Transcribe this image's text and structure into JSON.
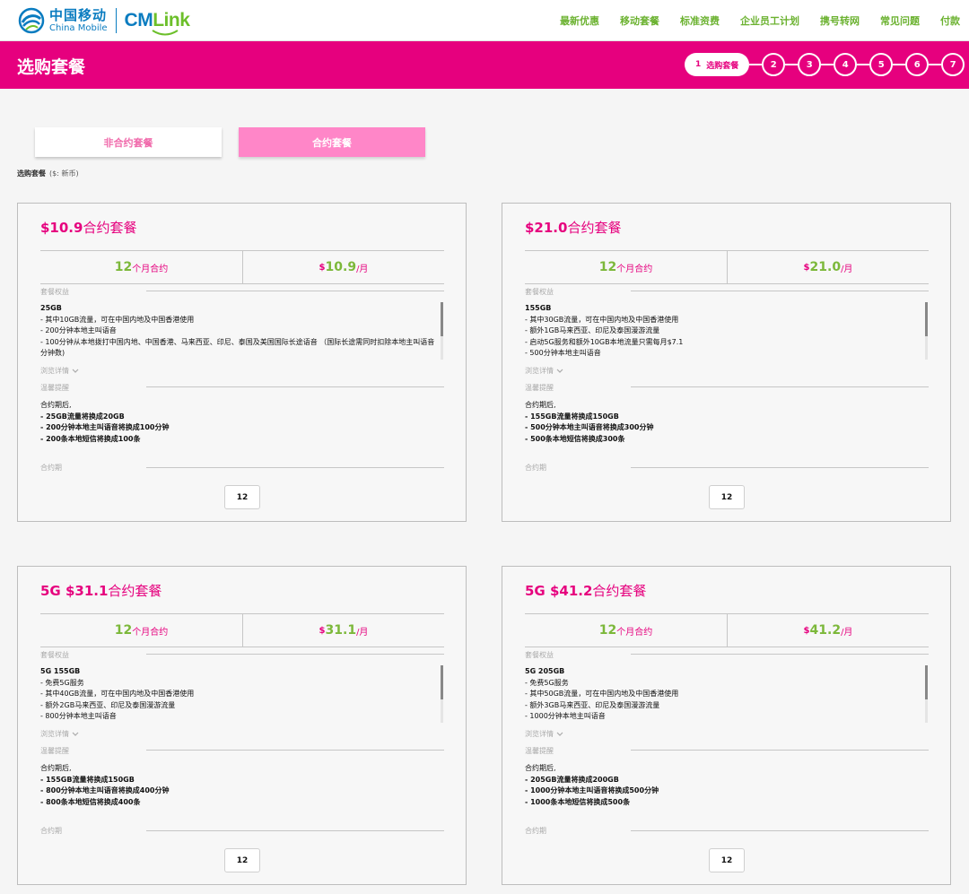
{
  "header": {
    "brand_cn": "中国移动",
    "brand_en": "China Mobile",
    "cmlink_cm": "CM",
    "cmlink_link": "Link",
    "nav": [
      "最新优惠",
      "移动套餐",
      "标准资费",
      "企业员工计划",
      "携号转网",
      "常见问题",
      "付款"
    ]
  },
  "banner": {
    "title": "选购套餐",
    "steps": {
      "active_number": "1",
      "active_label": "选购套餐",
      "others": [
        "2",
        "3",
        "4",
        "5",
        "6",
        "7"
      ]
    }
  },
  "tabs": {
    "noncontract": "非合约套餐",
    "contract": "合约套餐"
  },
  "subtitle": {
    "label": "选购套餐",
    "currency": "($: 新币)"
  },
  "colors": {
    "brand_pink": "#e6007e",
    "light_pink": "#ff86c8",
    "green": "#7cb83a",
    "blue": "#0a7cc0"
  },
  "plans": [
    {
      "title_price": "$10.9",
      "title_suffix": "合约套餐",
      "months": "12",
      "months_label": "个月合约",
      "price_symbol": "$",
      "price": "10.9",
      "per_month": "/月",
      "benefits_label": "套餐权益",
      "benefits": [
        "25GB",
        "- 其中10GB流量，可在中国内地及中国香港使用",
        "- 200分钟本地主叫语音",
        "- 100分钟从本地拨打中国内地、中国香港、马来西亚、印尼、泰国及美国国际长途语音 （国际长途需同时扣除本地主叫语音分钟数)"
      ],
      "details_link": "浏览详情",
      "reminder_label": "温馨提醒",
      "reminder": [
        "合约期后,",
        "- 25GB流量将换成20GB",
        "- 200分钟本地主叫语音将换成100分钟",
        "- 200条本地短信将换成100条"
      ],
      "period_label": "合约期",
      "period_option": "12"
    },
    {
      "title_price": "$21.0",
      "title_suffix": "合约套餐",
      "months": "12",
      "months_label": "个月合约",
      "price_symbol": "$",
      "price": "21.0",
      "per_month": "/月",
      "benefits_label": "套餐权益",
      "benefits": [
        "155GB",
        "- 其中30GB流量，可在中国内地及中国香港使用",
        "- 额外1GB马来西亚、印尼及泰国漫游流量",
        "- 启动5G服务和额外10GB本地流量只需每月$7.1",
        "- 500分钟本地主叫语音"
      ],
      "details_link": "浏览详情",
      "reminder_label": "温馨提醒",
      "reminder": [
        "合约期后,",
        "- 155GB流量将换成150GB",
        "- 500分钟本地主叫语音将换成300分钟",
        "- 500条本地短信将换成300条"
      ],
      "period_label": "合约期",
      "period_option": "12"
    },
    {
      "title_price": "5G $31.1",
      "title_suffix": "合约套餐",
      "months": "12",
      "months_label": "个月合约",
      "price_symbol": "$",
      "price": "31.1",
      "per_month": "/月",
      "benefits_label": "套餐权益",
      "benefits": [
        "5G 155GB",
        "- 免费5G服务",
        "- 其中40GB流量，可在中国内地及中国香港使用",
        "- 额外2GB马来西亚、印尼及泰国漫游流量",
        "- 800分钟本地主叫语音"
      ],
      "details_link": "浏览详情",
      "reminder_label": "温馨提醒",
      "reminder": [
        "合约期后,",
        "- 155GB流量将换成150GB",
        "- 800分钟本地主叫语音将换成400分钟",
        "- 800条本地短信将换成400条"
      ],
      "period_label": "合约期",
      "period_option": "12"
    },
    {
      "title_price": "5G $41.2",
      "title_suffix": "合约套餐",
      "months": "12",
      "months_label": "个月合约",
      "price_symbol": "$",
      "price": "41.2",
      "per_month": "/月",
      "benefits_label": "套餐权益",
      "benefits": [
        "5G 205GB",
        "- 免费5G服务",
        "- 其中50GB流量，可在中国内地及中国香港使用",
        "- 额外3GB马来西亚、印尼及泰国漫游流量",
        "- 1000分钟本地主叫语音"
      ],
      "details_link": "浏览详情",
      "reminder_label": "温馨提醒",
      "reminder": [
        "合约期后,",
        "- 205GB流量将换成200GB",
        "- 1000分钟本地主叫语音将换成500分钟",
        "- 1000条本地短信将换成500条"
      ],
      "period_label": "合约期",
      "period_option": "12"
    }
  ]
}
